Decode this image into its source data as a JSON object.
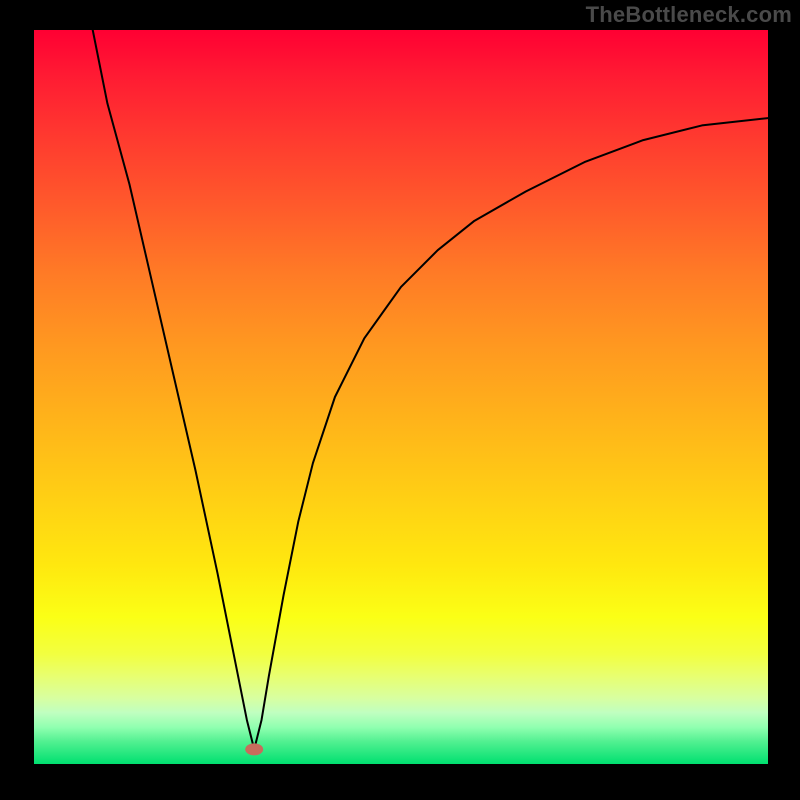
{
  "attribution": "TheBottleneck.com",
  "chart_data": {
    "type": "line",
    "title": "",
    "xlabel": "",
    "ylabel": "",
    "xlim": [
      0,
      100
    ],
    "ylim": [
      0,
      100
    ],
    "background_gradient": {
      "top": "#ff0033",
      "bottom": "#00e070"
    },
    "min_marker": {
      "x": 30,
      "y": 2,
      "color": "#c86c5c",
      "rx": 9,
      "ry": 6
    },
    "series": [
      {
        "name": "curve",
        "color": "#000000",
        "points": [
          {
            "x": 8,
            "y": 100
          },
          {
            "x": 10,
            "y": 90
          },
          {
            "x": 13,
            "y": 79
          },
          {
            "x": 16,
            "y": 66
          },
          {
            "x": 19,
            "y": 53
          },
          {
            "x": 22,
            "y": 40
          },
          {
            "x": 25,
            "y": 26
          },
          {
            "x": 27,
            "y": 16
          },
          {
            "x": 29,
            "y": 6
          },
          {
            "x": 30,
            "y": 2
          },
          {
            "x": 31,
            "y": 6
          },
          {
            "x": 32,
            "y": 12
          },
          {
            "x": 34,
            "y": 23
          },
          {
            "x": 36,
            "y": 33
          },
          {
            "x": 38,
            "y": 41
          },
          {
            "x": 41,
            "y": 50
          },
          {
            "x": 45,
            "y": 58
          },
          {
            "x": 50,
            "y": 65
          },
          {
            "x": 55,
            "y": 70
          },
          {
            "x": 60,
            "y": 74
          },
          {
            "x": 67,
            "y": 78
          },
          {
            "x": 75,
            "y": 82
          },
          {
            "x": 83,
            "y": 85
          },
          {
            "x": 91,
            "y": 87
          },
          {
            "x": 100,
            "y": 88
          }
        ]
      }
    ]
  }
}
